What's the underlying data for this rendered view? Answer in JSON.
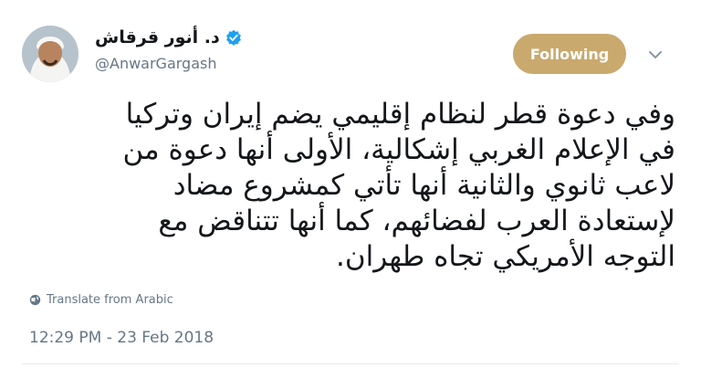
{
  "tweet": {
    "author": {
      "display_name": "د. أنور قرقاش",
      "handle": "@AnwarGargash",
      "verified": true,
      "avatar_icon": "person-in-ghutra-avatar"
    },
    "follow_button_label": "Following",
    "follow_button_color": "#c9a96e",
    "more_icon": "chevron-down-icon",
    "text_lines": [
      "وفي دعوة قطر لنظام إقليمي يضم إيران وتركيا",
      "في الإعلام الغربي إشكالية، الأولى أنها دعوة من",
      "لاعب ثانوي والثانية أنها تأتي كمشروع مضاد",
      "لإستعادة العرب لفضائهم، كما أنها تتناقض مع",
      "التوجه الأمريكي تجاه طهران."
    ],
    "translate_label": "Translate from Arabic",
    "translate_icon": "globe-icon",
    "timestamp": "12:29 PM - 23 Feb 2018"
  }
}
